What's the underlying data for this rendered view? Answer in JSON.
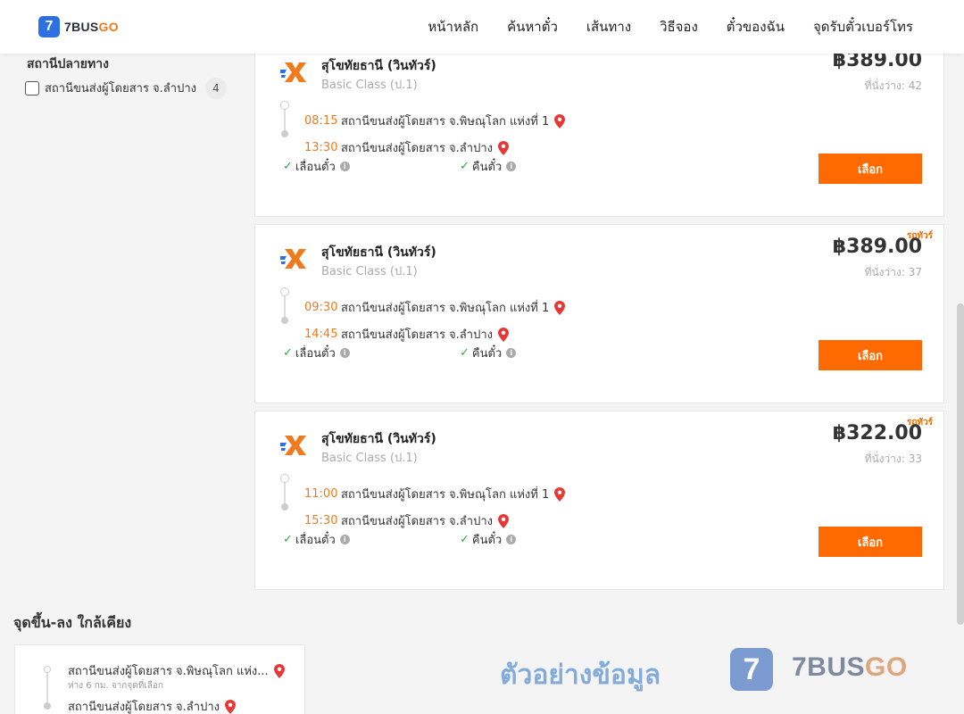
{
  "header": {
    "logo_mark": "7",
    "logo_part1": "7BUS",
    "logo_part2": "GO",
    "nav": [
      "หน้าหลัก",
      "ค้นหาตั๋ว",
      "เส้นทาง",
      "วิธีจอง",
      "ตั๋วของฉัน",
      "จุดรับตั๋วเบอร์โทร"
    ]
  },
  "filter": {
    "title": "สถานีปลายทาง",
    "option_label": "สถานีขนส่งผู้โดยสาร จ.ลำปาง",
    "option_count": "4"
  },
  "trips": [
    {
      "operator": "สุโขทัยธานี (วินทัวร์)",
      "class": "Basic Class (ป.1)",
      "price": "฿389.00",
      "seats": "ที่นั่งว่าง: 42",
      "tag": "",
      "depart_time": "08:15",
      "depart_place": "สถานีขนส่งผู้โดยสาร จ.พิษณุโลก แห่งที่ 1",
      "arrive_time": "13:30",
      "arrive_place": "สถานีขนส่งผู้โดยสาร จ.ลำปาง",
      "feature1": "เลื่อนตั๋ว",
      "feature2": "คืนตั๋ว",
      "button": "เลือก"
    },
    {
      "operator": "สุโขทัยธานี (วินทัวร์)",
      "class": "Basic Class (ป.1)",
      "price": "฿389.00",
      "seats": "ที่นั่งว่าง: 37",
      "tag": "รถทัวร์",
      "depart_time": "09:30",
      "depart_place": "สถานีขนส่งผู้โดยสาร จ.พิษณุโลก แห่งที่ 1",
      "arrive_time": "14:45",
      "arrive_place": "สถานีขนส่งผู้โดยสาร จ.ลำปาง",
      "feature1": "เลื่อนตั๋ว",
      "feature2": "คืนตั๋ว",
      "button": "เลือก"
    },
    {
      "operator": "สุโขทัยธานี (วินทัวร์)",
      "class": "Basic Class (ป.1)",
      "price": "฿322.00",
      "seats": "ที่นั่งว่าง: 33",
      "tag": "รถทัวร์",
      "depart_time": "11:00",
      "depart_place": "สถานีขนส่งผู้โดยสาร จ.พิษณุโลก แห่งที่ 1",
      "arrive_time": "15:30",
      "arrive_place": "สถานีขนส่งผู้โดยสาร จ.ลำปาง",
      "feature1": "เลื่อนตั๋ว",
      "feature2": "คืนตั๋ว",
      "button": "เลือก"
    }
  ],
  "nearby": {
    "title": "จุดขึ้น-ลง ใกล้เคียง",
    "stop1": "สถานีขนส่งผู้โดยสาร จ.พิษณุโลก แห่ง...",
    "stop1_sub": "ห่าง 6 กม. จากจุดที่เลือก",
    "stop2": "สถานีขนส่งผู้โดยสาร จ.ลำปาง"
  },
  "watermark": {
    "text": "ตัวอย่างข้อมูล",
    "logo_mark": "7",
    "brand1": "7BUS",
    "brand2": "GO"
  },
  "colors": {
    "accent": "#ff6a00",
    "time": "#f07a1e",
    "check": "#2eaa4a",
    "pin": "#e53935"
  }
}
